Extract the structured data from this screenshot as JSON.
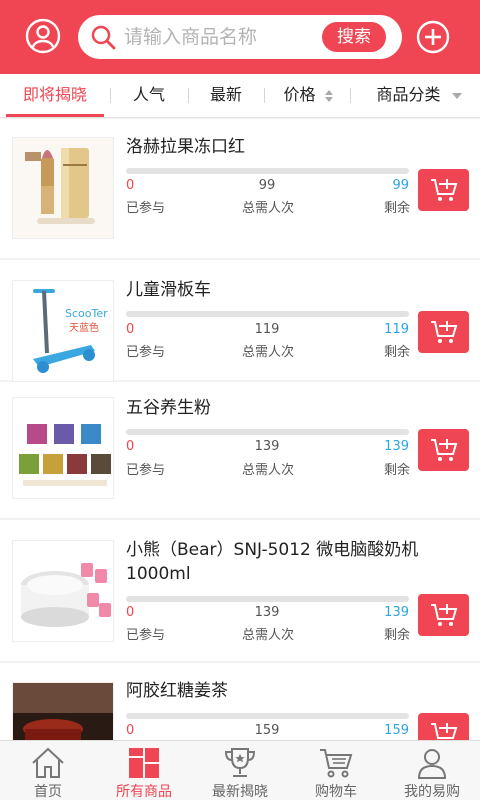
{
  "header": {
    "search_placeholder": "请输入商品名称",
    "search_button": "搜索"
  },
  "filters": {
    "tabs": [
      {
        "label": "即将揭晓",
        "active": true
      },
      {
        "label": "人气"
      },
      {
        "label": "最新"
      },
      {
        "label": "价格"
      },
      {
        "label": "商品分类"
      }
    ]
  },
  "list_labels": {
    "joined": "已参与",
    "total": "总需人次",
    "remaining": "剩余"
  },
  "products": [
    {
      "name": "洛赫拉果冻口红",
      "joined": "0",
      "total": "99",
      "remaining": "99"
    },
    {
      "name": "儿童滑板车",
      "joined": "0",
      "total": "119",
      "remaining": "119",
      "thumb_text_1": "ScooTer",
      "thumb_text_2": "天蓝色"
    },
    {
      "name": "五谷养生粉",
      "joined": "0",
      "total": "139",
      "remaining": "139"
    },
    {
      "name": "小熊（Bear）SNJ-5012 微电脑酸奶机1000ml",
      "joined": "0",
      "total": "139",
      "remaining": "139"
    },
    {
      "name": "阿胶红糖姜茶",
      "joined": "0",
      "total": "159",
      "remaining": "159"
    }
  ],
  "bottom_nav": [
    {
      "label": "首页",
      "icon": "home-icon"
    },
    {
      "label": "所有商品",
      "icon": "grid-icon",
      "active": true
    },
    {
      "label": "最新揭晓",
      "icon": "trophy-icon"
    },
    {
      "label": "购物车",
      "icon": "cart-icon"
    },
    {
      "label": "我的易购",
      "icon": "user-icon"
    }
  ],
  "colors": {
    "brand": "#f04552",
    "remaining": "#2aa6e0"
  }
}
